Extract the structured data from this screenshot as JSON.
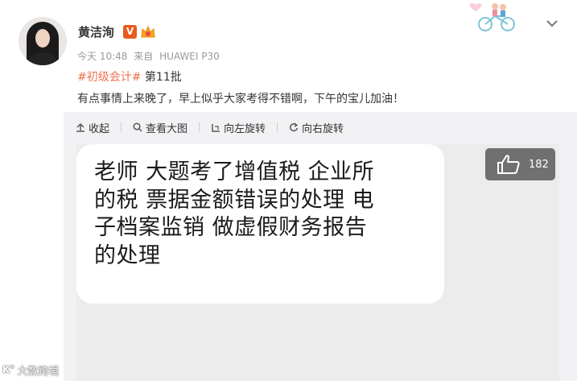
{
  "post": {
    "author": "黄洁洵",
    "verified_badge": "V",
    "time": "今天 10:48",
    "source_prefix": "来自",
    "device": "HUAWEI P30",
    "hashtag": "#初级会计#",
    "hashtag_suffix": "第11批",
    "text": "有点事情上来晚了，早上似乎大家考得不错啊，下午的宝儿加油！"
  },
  "toolbar": {
    "collapse": "收起",
    "view_large": "查看大图",
    "rotate_left": "向左旋转",
    "rotate_right": "向右旋转"
  },
  "image": {
    "lines": [
      "老师  大题考了增值税 企业所",
      "的税  票据金额错误的处理  电",
      "子档案监销  做虚假财务报告",
      "的处理"
    ],
    "like_count": "182"
  },
  "watermark": {
    "logo": "K°",
    "text": "大数跨境"
  },
  "colors": {
    "hashtag": "#eb7350",
    "verified": "#e85a1e",
    "panel_bg": "#f2f2f5"
  }
}
